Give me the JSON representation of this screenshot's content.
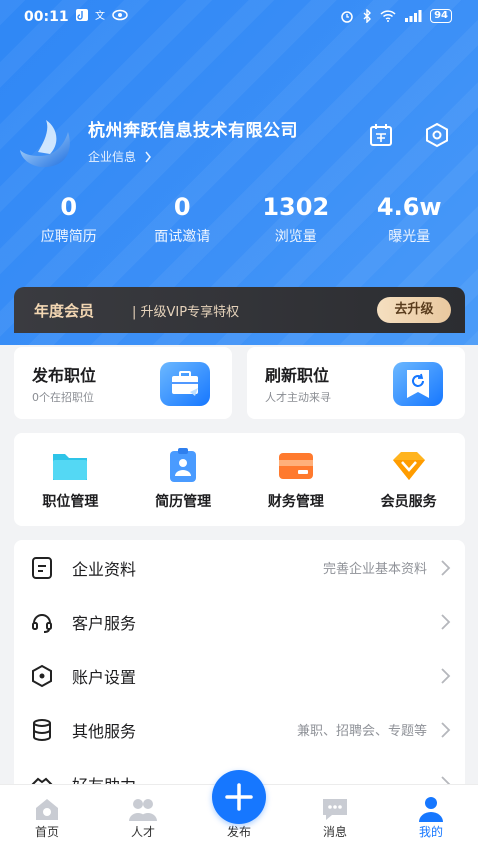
{
  "status_bar": {
    "time": "00:11",
    "left_icons": [
      "tiktok-icon",
      "translate-icon",
      "eye-icon"
    ],
    "right_icons": [
      "alarm-icon",
      "bluetooth-icon",
      "wifi-icon",
      "signal-icon"
    ],
    "battery": "94"
  },
  "company": {
    "name": "杭州奔跃信息技术有限公司",
    "info_link": "企业信息",
    "icons": [
      "calendar-sign-icon",
      "settings-hex-icon"
    ]
  },
  "stats": [
    {
      "value": "0",
      "label": "应聘简历"
    },
    {
      "value": "0",
      "label": "面试邀请"
    },
    {
      "value": "1302",
      "label": "浏览量"
    },
    {
      "value": "4.6w",
      "label": "曝光量"
    }
  ],
  "vip": {
    "title": "年度会员",
    "desc": "| 升级VIP专享特权",
    "button": "去升级"
  },
  "cards": {
    "publish": {
      "title": "发布职位",
      "sub": "0个在招职位"
    },
    "refresh": {
      "title": "刷新职位",
      "sub": "人才主动来寻"
    }
  },
  "grid": [
    {
      "label": "职位管理",
      "icon": "folder-icon"
    },
    {
      "label": "简历管理",
      "icon": "resume-icon"
    },
    {
      "label": "财务管理",
      "icon": "wallet-icon"
    },
    {
      "label": "会员服务",
      "icon": "vip-diamond-icon"
    }
  ],
  "list": [
    {
      "label": "企业资料",
      "hint": "完善企业基本资料",
      "icon": "document-icon"
    },
    {
      "label": "客户服务",
      "hint": "",
      "icon": "headset-icon"
    },
    {
      "label": "账户设置",
      "hint": "",
      "icon": "hex-settings-icon"
    },
    {
      "label": "其他服务",
      "hint": "兼职、招聘会、专题等",
      "icon": "database-icon"
    },
    {
      "label": "好友助力",
      "hint": "",
      "icon": "handshake-icon"
    }
  ],
  "nav": [
    {
      "label": "首页",
      "icon": "home-icon"
    },
    {
      "label": "人才",
      "icon": "people-icon"
    },
    {
      "label": "发布",
      "icon": "plus-icon"
    },
    {
      "label": "消息",
      "icon": "message-icon"
    },
    {
      "label": "我的",
      "icon": "profile-icon"
    }
  ],
  "colors": {
    "primary": "#1677ff",
    "header": "#3b8ff7",
    "vip_gold": "#f3d7b3"
  }
}
